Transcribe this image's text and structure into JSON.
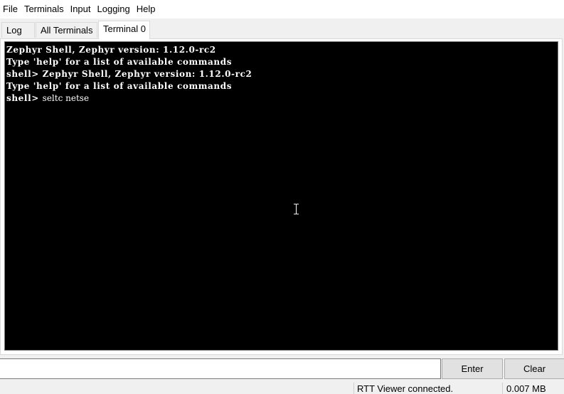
{
  "menubar": {
    "items": [
      "File",
      "Terminals",
      "Input",
      "Logging",
      "Help"
    ]
  },
  "tabs": [
    {
      "label": "Log",
      "active": false
    },
    {
      "label": "All Terminals",
      "active": false
    },
    {
      "label": "Terminal 0",
      "active": true
    }
  ],
  "terminal": {
    "lines": [
      "Zephyr Shell, Zephyr version: 1.12.0-rc2",
      "Type 'help' for a list of available commands",
      "shell> Zephyr Shell, Zephyr version: 1.12.0-rc2",
      "Type 'help' for a list of available commands"
    ],
    "prompt": "shell> ",
    "typed": "seltc netse",
    "background_color": "#000000",
    "text_color": "#ffffff"
  },
  "input": {
    "value": "",
    "enter_label": "Enter",
    "clear_label": "Clear"
  },
  "status": {
    "connection": "RTT Viewer connected.",
    "data_size": "0.007 MB"
  }
}
